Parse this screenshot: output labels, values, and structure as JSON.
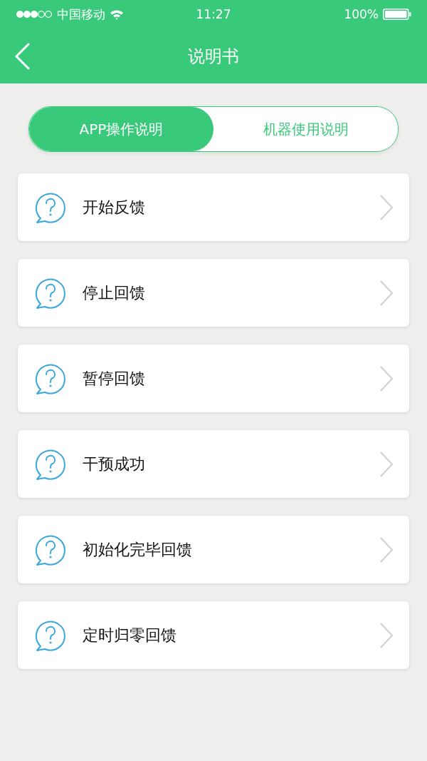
{
  "status_bar": {
    "carrier": "中国移动",
    "time": "11:27",
    "battery": "100%"
  },
  "nav_bar": {
    "title": "说明书"
  },
  "tabs": [
    {
      "label": "APP操作说明",
      "selected": true
    },
    {
      "label": "机器使用说明",
      "selected": false
    }
  ],
  "items": [
    {
      "label": "开始反馈"
    },
    {
      "label": "停止回馈"
    },
    {
      "label": "暂停回馈"
    },
    {
      "label": "干预成功"
    },
    {
      "label": "初始化完毕回馈"
    },
    {
      "label": "定时归零回馈"
    }
  ]
}
